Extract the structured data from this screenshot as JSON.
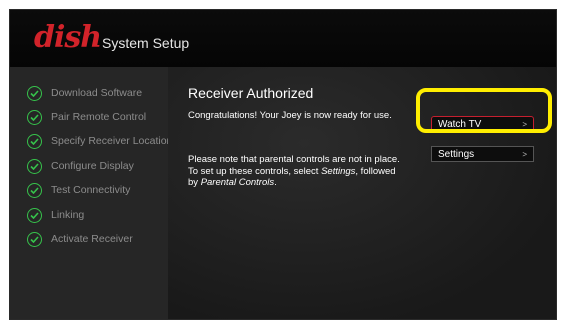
{
  "header": {
    "brand": "dish",
    "title": "System Setup"
  },
  "sidebar": {
    "steps": [
      {
        "label": "Download Software",
        "status": "complete"
      },
      {
        "label": "Pair Remote Control",
        "status": "complete"
      },
      {
        "label": "Specify Receiver Location",
        "status": "complete"
      },
      {
        "label": "Configure Display",
        "status": "complete"
      },
      {
        "label": "Test Connectivity",
        "status": "complete"
      },
      {
        "label": "Linking",
        "status": "complete"
      },
      {
        "label": "Activate Receiver",
        "status": "complete"
      }
    ]
  },
  "main": {
    "title": "Receiver Authorized",
    "congrats": "Congratulations! Your Joey is now ready for use.",
    "note_line1": "Please note that parental controls are not in place.",
    "note_line2_prefix": "To set up these controls, select ",
    "note_line2_em": "Settings",
    "note_line2_suffix": ", followed",
    "note_line3_prefix": "by ",
    "note_line3_em": "Parental Controls",
    "note_line3_suffix": "."
  },
  "buttons": {
    "watch_tv": {
      "label": "Watch TV",
      "chevron": ">"
    },
    "settings": {
      "label": "Settings",
      "chevron": ">"
    }
  },
  "colors": {
    "brand_red": "#d2232a",
    "check_green": "#36c24b",
    "focus_red": "#c61f2f",
    "highlight_yellow": "#ffee00"
  }
}
